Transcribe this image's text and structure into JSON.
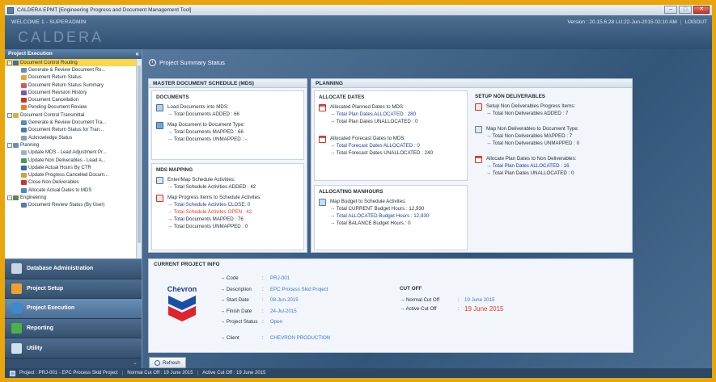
{
  "window": {
    "title": "CALDERA EPMT [Engineering Progress and Document Management Tool]"
  },
  "header": {
    "welcome": "WELCOME 1 - SUPERADMIN",
    "version": "Version : 20.15.6.28 LU:22-Jun-2015 02:10 AM",
    "separator": "|",
    "logout": "LOGOUT",
    "logo": "CALDERA"
  },
  "sidebar": {
    "title": "Project Execution",
    "tree": [
      {
        "label": "Document Control Routing",
        "level": 0,
        "expander": "-",
        "selected": true,
        "icon_color": "#3b6fb0"
      },
      {
        "label": "Generate & Review Document Ro...",
        "level": 1,
        "icon_color": "#6c8fb8"
      },
      {
        "label": "Document Return Status",
        "level": 1,
        "icon_color": "#e8a73a"
      },
      {
        "label": "Document Return Status Summary",
        "level": 1,
        "icon_color": "#d45a5a"
      },
      {
        "label": "Document Revision History",
        "level": 1,
        "icon_color": "#7a5ab0"
      },
      {
        "label": "Document Cancellation",
        "level": 1,
        "icon_color": "#c0392b"
      },
      {
        "label": "Pending Document Review",
        "level": 1,
        "icon_color": "#e67e22"
      },
      {
        "label": "Document Control Transmittal",
        "level": 0,
        "expander": "-",
        "icon_color": "#d4b04a"
      },
      {
        "label": "Generate & Review Document Tra...",
        "level": 1,
        "icon_color": "#5a8ac0"
      },
      {
        "label": "Document Return Status for Tran...",
        "level": 1,
        "icon_color": "#4a7ab0"
      },
      {
        "label": "Acknowledge Status",
        "level": 1,
        "icon_color": "#8aa0b8"
      },
      {
        "label": "Planning",
        "level": 0,
        "expander": "-",
        "icon_color": "#6a8fb8"
      },
      {
        "label": "Update MDS - Lead Adjustment Pr...",
        "level": 1,
        "icon_color": "#9ab4d0"
      },
      {
        "label": "Update Non Deliverables - Lead A...",
        "level": 1,
        "icon_color": "#4a9a5a"
      },
      {
        "label": "Update Actual Hours By CTR",
        "level": 1,
        "icon_color": "#3a6aa0"
      },
      {
        "label": "Update Progress Cancelled Docum...",
        "level": 1,
        "icon_color": "#d4a03a"
      },
      {
        "label": "Close Non Deliverables",
        "level": 1,
        "icon_color": "#c0392b"
      },
      {
        "label": "Allocate Actual Dates to MDS",
        "level": 1,
        "icon_color": "#4a8ac0"
      },
      {
        "label": "Engineering",
        "level": 0,
        "expander": "-",
        "icon_color": "#5a8a4a"
      },
      {
        "label": "Document Review Status (By User)",
        "level": 1,
        "icon_color": "#5a7ab0"
      }
    ],
    "nav": [
      {
        "label": "Database Administration",
        "icon": "tools-icon",
        "icon_color": "#c9d6e3"
      },
      {
        "label": "Project Setup",
        "icon": "setup-icon",
        "icon_color": "#f0a030"
      },
      {
        "label": "Project Execution",
        "icon": "execution-icon",
        "icon_color": "#3a8ad0",
        "active": true
      },
      {
        "label": "Reporting",
        "icon": "chart-icon",
        "icon_color": "#4ab04a"
      },
      {
        "label": "Utility",
        "icon": "utility-icon",
        "icon_color": "#d0e0f0"
      }
    ]
  },
  "main": {
    "section_title": "Project Summary Status",
    "mds_panel": {
      "title": "MASTER DOCUMENT SCHEDULE (MDS)",
      "documents": {
        "title": "DOCUMENTS",
        "load_title": "Load Documents into MDS:",
        "load_added": "→ Total Documents ADDED : 66",
        "map_title": "Map Document to Document Type:",
        "map_mapped": "→ Total Documents MAPPED : 66",
        "map_unmapped": "→ Total Documents UNMAPPED : -"
      },
      "mapping": {
        "title": "MDS MAPPING",
        "enter_title": "Enter/Map Schedule Activities:",
        "enter_added": "→ Total Schedule Activities ADDED : 42",
        "map_title": "Map Progress Items to Schedule Activites:",
        "close": "→ Total Schedule Activites CLOSE: 0",
        "open": "→ Total Schedule Activites OPEN : 42",
        "mapped": "→ Total Documents MAPPED : 76",
        "unmapped": "→ Total Documents UNMAPPED : 0"
      }
    },
    "planning_panel": {
      "title": "PLANNING",
      "allocate": {
        "title": "ALLOCATE DATES",
        "plan_title": "Allocated Planned Dates to MDS:",
        "plan_allocated": "→ Total Plan Dates ALLOCATED : 280",
        "plan_unallocated": "→ Total Plan Dates UNALLOCATED : 0",
        "forecast_title": "Allocated Forecast Dates to MDS:",
        "forecast_allocated": "→ Total Forecast Dates ALLOCATED : 0",
        "forecast_unallocated": "→ Total Forecast Dates UNALLOCATED : 240"
      },
      "manhours": {
        "title": "ALLOCATING MANHOURS",
        "budget_title": "Map Budget to Schedule Activites:",
        "current": "→ Total CURRENT Budget Hours : 12,930",
        "allocated": "→ Total ALLOCATED Budget Hours : 12,930",
        "balance": "→ Total BALANCE Budget Hours : 0"
      },
      "nondeliv": {
        "title": "SETUP NON DELIVERABLES",
        "setup_title": "Setup Non Deliverables Progress Items:",
        "setup_added": "→ Total Non Deliverables ADDED : 7",
        "map_title": "Map Non Deliverables to Document Type:",
        "map_mapped": "→ Total Non Deliverables MAPPED : 7",
        "map_unmapped": "→ Total Non Deliverables UNMAPPED : 0",
        "alloc_title": "Allocate Plan Dates to Non Deliverables:",
        "alloc_allocated": "→ Total Plan Dates ALLOCATED : 16",
        "alloc_unallocated": "→ Total Plan Dates UNALLOCATED : 0"
      }
    },
    "project_info": {
      "title": "CURRENT PROJECT INFO",
      "logo_text": "Chevron",
      "rows": [
        {
          "key": "→ Code",
          "value": "PRJ-001"
        },
        {
          "key": "→ Description",
          "value": "EPC Process Skid Project"
        },
        {
          "key": "→ Start Date",
          "value": "08-Jun-2015"
        },
        {
          "key": "→ Finish Date",
          "value": "24-Jul-2015"
        },
        {
          "key": "→ Project Status",
          "value": "Open"
        },
        {
          "key": "→ Client",
          "value": "CHEVRON PRODUCTION"
        }
      ],
      "colon": ":",
      "cutoff": {
        "title": "CUT OFF",
        "normal_label": "→ Normal Cut Off",
        "normal_value": "19 June 2015",
        "active_label": "→ Active Cut Off",
        "active_value": "19 June 2015"
      }
    },
    "refresh_label": "Refresh"
  },
  "statusbar": {
    "project": "Project : PRJ-001 - EPC Process Skid Project",
    "normal": "Normal Cut Off : 19 June 2015",
    "active": "Active Cut Off : 19 June 2015",
    "separator": "|"
  }
}
